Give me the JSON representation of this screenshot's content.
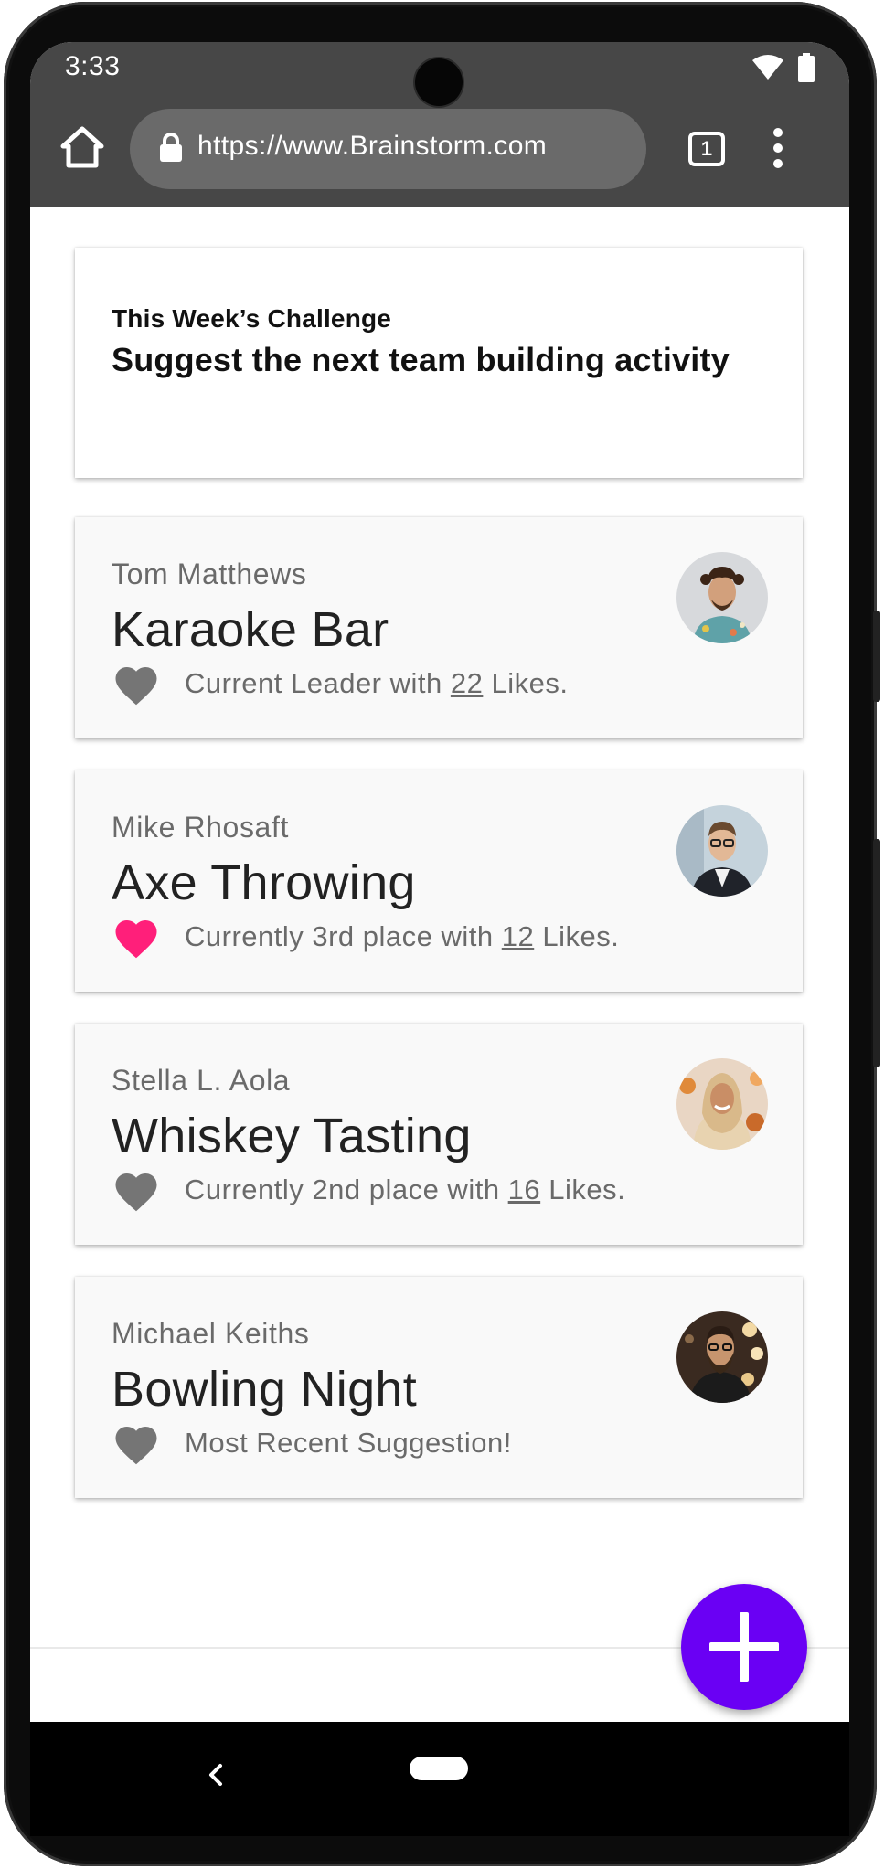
{
  "statusbar": {
    "time": "3:33",
    "icons": [
      "wifi-icon",
      "battery-icon"
    ]
  },
  "browser": {
    "url": "https://www.Brainstorm.com",
    "tab_count": "1",
    "icons": [
      "home-icon",
      "lock-icon",
      "tabs-icon",
      "more-vert-icon"
    ]
  },
  "challenge": {
    "lead": "This Week’s Challenge",
    "headline": "Suggest the next team building activity"
  },
  "suggestions": [
    {
      "author": "Tom Matthews",
      "title": "Karaoke Bar",
      "status_prefix": "Current Leader with ",
      "likes": "22",
      "status_suffix": " Likes.",
      "liked": false
    },
    {
      "author": "Mike Rhosaft",
      "title": "Axe Throwing",
      "status_prefix": "Currently 3rd place with ",
      "likes": "12",
      "status_suffix": " Likes.",
      "liked": true
    },
    {
      "author": "Stella L. Aola",
      "title": "Whiskey Tasting",
      "status_prefix": "Currently 2nd place with ",
      "likes": "16",
      "status_suffix": " Likes.",
      "liked": false
    },
    {
      "author": "Michael Keiths",
      "title": "Bowling Night",
      "status_prefix": "Most Recent Suggestion!",
      "likes": "",
      "status_suffix": "",
      "liked": false
    }
  ],
  "fab": {
    "icon": "plus-icon"
  },
  "colors": {
    "accent": "#6a00f4",
    "heart_liked": "#ff1f7a",
    "heart_default": "#757575",
    "chrome_bar": "#474747"
  }
}
